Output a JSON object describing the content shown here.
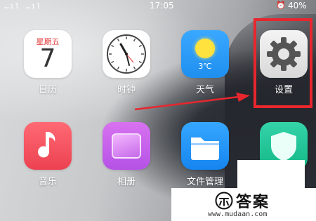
{
  "status_bar": {
    "signal_text": "…ıl …ıl",
    "time": "17:05",
    "battery": "40%"
  },
  "apps": {
    "calendar": {
      "label": "日历",
      "weekday": "星期五",
      "day": "7"
    },
    "clock": {
      "label": "时钟"
    },
    "weather": {
      "label": "天气",
      "temperature": "3℃"
    },
    "settings": {
      "label": "设置"
    },
    "music": {
      "label": "音乐"
    },
    "photos": {
      "label": "相册"
    },
    "files": {
      "label": "文件管理"
    },
    "security": {
      "label": ""
    }
  },
  "highlight": {
    "color": "#e8262d"
  },
  "watermark": {
    "title": "答案",
    "url": "www.mudaan.com"
  }
}
